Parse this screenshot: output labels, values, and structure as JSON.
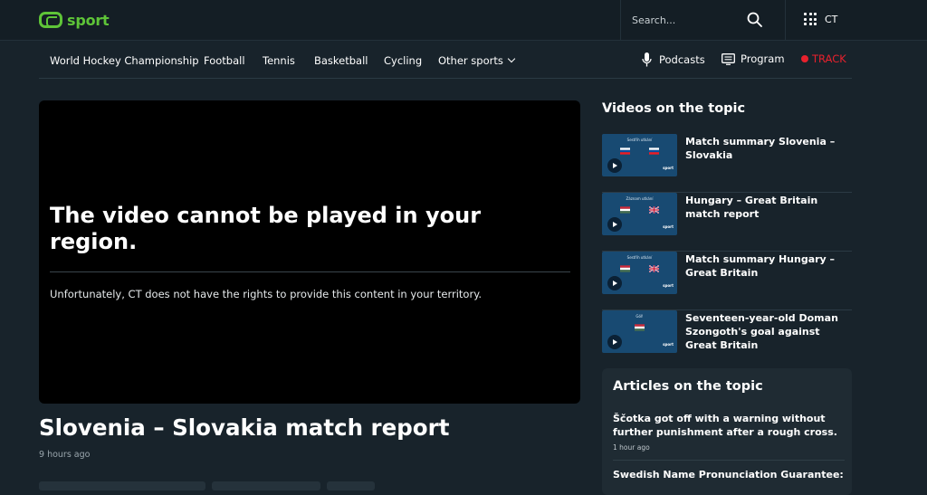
{
  "header": {
    "logo_text": "sport",
    "search_placeholder": "Search...",
    "apps_label": "CT"
  },
  "nav": {
    "items": [
      "World Hockey Championship",
      "Football",
      "Tennis",
      "Basketball",
      "Cycling"
    ],
    "more_label": "Other sports",
    "podcasts_label": "Podcasts",
    "program_label": "Program",
    "track_label": "TRACK"
  },
  "video": {
    "title": "The video cannot be played in your region.",
    "message": "Unfortunately, CT does not have the rights to provide this content in your territory."
  },
  "article": {
    "title": "Slovenia – Slovakia match report",
    "time": "9 hours ago"
  },
  "sidebar": {
    "videos_heading": "Videos on the topic",
    "videos": [
      {
        "title": "Match summary Slovenia – Slovakia",
        "thumb_caption": "Sestřih utkání"
      },
      {
        "title": "Hungary – Great Britain match report",
        "thumb_caption": "Záznam utkání"
      },
      {
        "title": "Match summary Hungary – Great Britain",
        "thumb_caption": "Sestřih utkání"
      },
      {
        "title": "Seventeen-year-old Doman Szongoth's goal against Great Britain",
        "thumb_caption": "Gól!"
      }
    ],
    "articles_heading": "Articles on the topic",
    "articles": [
      {
        "title": "Ščotka got off with a warning without further punishment after a rough cross.",
        "time": "1 hour ago"
      },
      {
        "title": "Swedish Name Pronunciation Guarantee:"
      }
    ]
  },
  "colors": {
    "brand": "#5ec438",
    "track": "#e8212d",
    "background": "#18232b"
  }
}
